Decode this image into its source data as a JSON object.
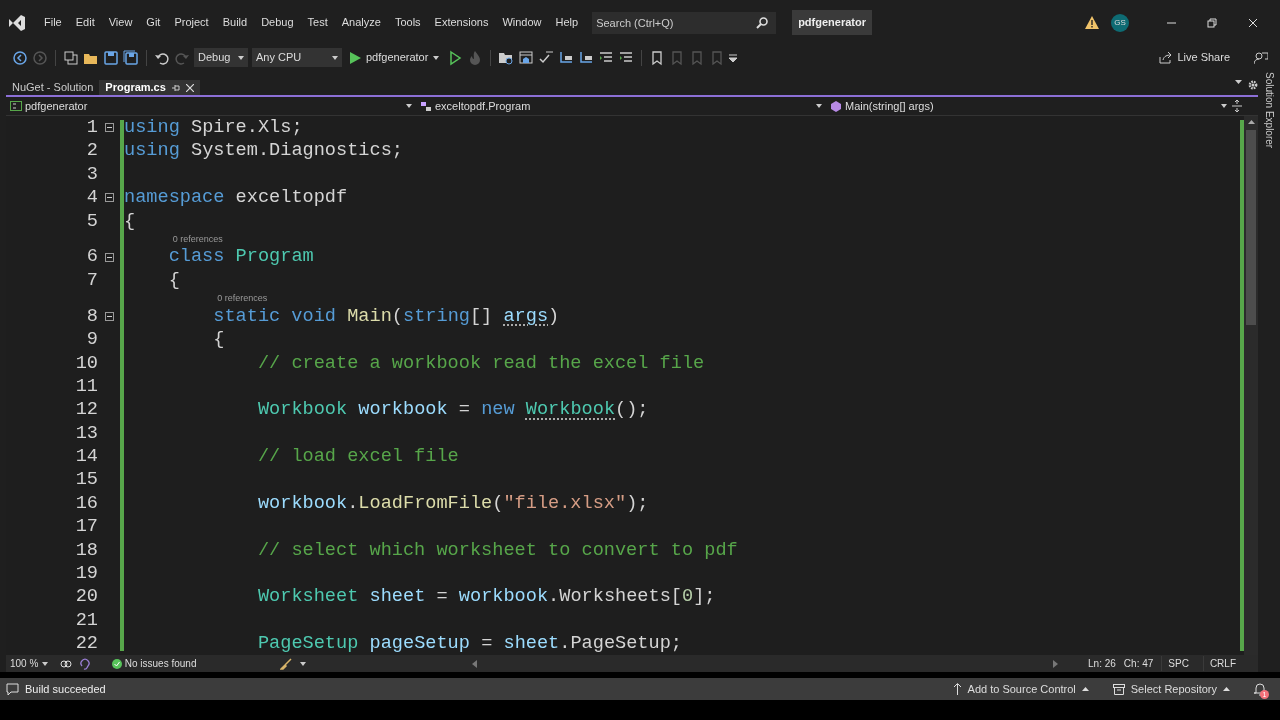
{
  "menu": [
    "File",
    "Edit",
    "View",
    "Git",
    "Project",
    "Build",
    "Debug",
    "Test",
    "Analyze",
    "Tools",
    "Extensions",
    "Window",
    "Help"
  ],
  "search": {
    "placeholder": "Search (Ctrl+Q)"
  },
  "solution_name": "pdfgenerator",
  "account": {
    "initials": "GS"
  },
  "toolbar": {
    "left_buttons": [
      {
        "kind": "back",
        "disabled": false
      },
      {
        "kind": "forward",
        "disabled": true
      },
      {
        "kind": "new-item",
        "disabled": false
      },
      {
        "kind": "open",
        "disabled": false
      },
      {
        "kind": "save",
        "disabled": false
      },
      {
        "kind": "save-all",
        "disabled": false
      },
      {
        "kind": "undo",
        "disabled": false
      },
      {
        "kind": "redo",
        "disabled": true
      }
    ],
    "configuration": "Debug",
    "platform": "Any CPU",
    "start_target": "pdfgenerator",
    "right_buttons": [
      {
        "kind": "run-outline",
        "disabled": false
      },
      {
        "kind": "flame",
        "disabled": true
      },
      {
        "kind": "folder-search",
        "disabled": false
      },
      {
        "kind": "window",
        "disabled": false
      },
      {
        "kind": "spell",
        "disabled": false
      },
      {
        "kind": "step",
        "disabled": false
      },
      {
        "kind": "step",
        "disabled": false
      },
      {
        "kind": "lines",
        "disabled": false
      },
      {
        "kind": "lines",
        "disabled": false
      },
      {
        "kind": "bookmark",
        "disabled": false
      },
      {
        "kind": "bookmark",
        "disabled": true
      },
      {
        "kind": "bookmark",
        "disabled": true
      },
      {
        "kind": "bookmark",
        "disabled": true
      }
    ],
    "live_share": "Live Share"
  },
  "tabs": [
    {
      "label": "NuGet - Solution",
      "selected": false
    },
    {
      "label": "Program.cs",
      "selected": true
    }
  ],
  "nav_bar": {
    "project": "pdfgenerator",
    "type": "exceltopdf.Program",
    "member": "Main(string[] args)"
  },
  "editor": {
    "lines": [
      {
        "number": "1",
        "fold": true,
        "tokens": [
          {
            "t": "using ",
            "kind": "keyword"
          },
          {
            "t": "Spire.Xls;",
            "kind": "plain"
          }
        ]
      },
      {
        "number": "2",
        "fold": false,
        "tokens": [
          {
            "t": "using ",
            "kind": "keyword"
          },
          {
            "t": "System.Diagnostics;",
            "kind": "plain"
          }
        ]
      },
      {
        "number": "3",
        "fold": false
      },
      {
        "number": "4",
        "fold": true,
        "tokens": [
          {
            "t": "namespace ",
            "kind": "keyword"
          },
          {
            "t": "exceltopdf",
            "kind": "plain"
          }
        ]
      },
      {
        "number": "5",
        "fold": false,
        "tokens": [
          {
            "t": "{",
            "kind": "plain"
          }
        ]
      },
      {
        "number": "6",
        "fold": true,
        "lens": "0 references",
        "tokens": [
          {
            "t": "    class ",
            "kind": "keyword"
          },
          {
            "t": "Program",
            "kind": "type"
          }
        ]
      },
      {
        "number": "7",
        "fold": false,
        "tokens": [
          {
            "t": "    {",
            "kind": "plain"
          }
        ]
      },
      {
        "number": "8",
        "fold": true,
        "lens": "0 references",
        "tokens": [
          {
            "t": "        static void ",
            "kind": "keyword"
          },
          {
            "t": "Main",
            "kind": "method"
          },
          {
            "t": "(",
            "kind": "plain"
          },
          {
            "t": "string",
            "kind": "keyword"
          },
          {
            "t": "[] ",
            "kind": "plain"
          },
          {
            "t": "args",
            "kind": "name",
            "dotted": true
          },
          {
            "t": ")",
            "kind": "plain"
          }
        ]
      },
      {
        "number": "9",
        "fold": false,
        "tokens": [
          {
            "t": "        {",
            "kind": "plain"
          }
        ]
      },
      {
        "number": "10",
        "fold": false,
        "tokens": [
          {
            "t": "            // create a workbook read the excel file",
            "kind": "comment"
          }
        ]
      },
      {
        "number": "11",
        "fold": false
      },
      {
        "number": "12",
        "fold": false,
        "tokens": [
          {
            "t": "            Workbook ",
            "kind": "type"
          },
          {
            "t": "workbook",
            "kind": "name"
          },
          {
            "t": " = ",
            "kind": "plain"
          },
          {
            "t": "new ",
            "kind": "keyword"
          },
          {
            "t": "Workbook",
            "kind": "type",
            "dotted": true
          },
          {
            "t": "();",
            "kind": "plain"
          }
        ]
      },
      {
        "number": "13",
        "fold": false
      },
      {
        "number": "14",
        "fold": false,
        "tokens": [
          {
            "t": "            // load excel file",
            "kind": "comment"
          }
        ]
      },
      {
        "number": "15",
        "fold": false
      },
      {
        "number": "16",
        "fold": false,
        "tokens": [
          {
            "t": "            workbook",
            "kind": "name"
          },
          {
            "t": ".",
            "kind": "plain"
          },
          {
            "t": "LoadFromFile",
            "kind": "method"
          },
          {
            "t": "(",
            "kind": "plain"
          },
          {
            "t": "\"file.xlsx\"",
            "kind": "string"
          },
          {
            "t": ");",
            "kind": "plain"
          }
        ]
      },
      {
        "number": "17",
        "fold": false
      },
      {
        "number": "18",
        "fold": false,
        "tokens": [
          {
            "t": "            // select which worksheet to convert to pdf",
            "kind": "comment"
          }
        ]
      },
      {
        "number": "19",
        "fold": false
      },
      {
        "number": "20",
        "fold": false,
        "tokens": [
          {
            "t": "            Worksheet ",
            "kind": "type"
          },
          {
            "t": "sheet",
            "kind": "name"
          },
          {
            "t": " = ",
            "kind": "plain"
          },
          {
            "t": "workbook",
            "kind": "name"
          },
          {
            "t": ".Worksheets[",
            "kind": "plain"
          },
          {
            "t": "0",
            "kind": "number"
          },
          {
            "t": "];",
            "kind": "plain"
          }
        ]
      },
      {
        "number": "21",
        "fold": false
      },
      {
        "number": "22",
        "fold": false,
        "tokens": [
          {
            "t": "            PageSetup ",
            "kind": "type"
          },
          {
            "t": "pageSetup",
            "kind": "name"
          },
          {
            "t": " = ",
            "kind": "plain"
          },
          {
            "t": "sheet",
            "kind": "name"
          },
          {
            "t": ".PageSetup;",
            "kind": "plain"
          }
        ]
      }
    ]
  },
  "editor_status": {
    "zoom": "100 %",
    "issues": "No issues found",
    "line": "Ln: 26",
    "column": "Ch: 47",
    "whitespace": "SPC",
    "line_ending": "CRLF"
  },
  "status_bar": {
    "message": "Build succeeded",
    "source_control": "Add to Source Control",
    "repository": "Select Repository",
    "notifications": "1"
  },
  "side_panel": {
    "label": "Solution Explorer"
  }
}
